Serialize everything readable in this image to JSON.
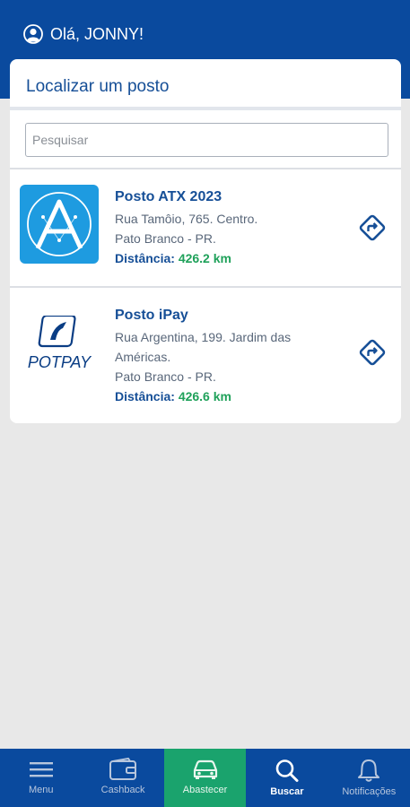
{
  "header": {
    "greeting": "Olá, JONNY!",
    "icon": "user-circle-icon"
  },
  "card": {
    "title": "Localizar um posto",
    "search_placeholder": "Pesquisar"
  },
  "stations": [
    {
      "name": "Posto ATX 2023",
      "address": "Rua Tamôio, 765. Centro.",
      "city": "Pato Branco - PR.",
      "distance_label": "Distância:",
      "distance_value": "426.2 km",
      "logo": "atx-logo"
    },
    {
      "name": "Posto iPay",
      "address": "Rua Argentina, 199. Jardim das Américas.",
      "city": "Pato Branco - PR.",
      "distance_label": "Distância:",
      "distance_value": "426.6 km",
      "logo": "potpay-logo",
      "logo_text": "POTPAY"
    }
  ],
  "nav": [
    {
      "label": "Menu",
      "icon": "hamburger-icon"
    },
    {
      "label": "Cashback",
      "icon": "wallet-icon"
    },
    {
      "label": "Abastecer",
      "icon": "car-icon",
      "state": "highlighted"
    },
    {
      "label": "Buscar",
      "icon": "search-icon",
      "state": "selected"
    },
    {
      "label": "Notificações",
      "icon": "bell-icon"
    }
  ],
  "colors": {
    "primary": "#0a4a9e",
    "title_blue": "#164f97",
    "distance_green": "#1fa15a",
    "nav_highlight": "#1aa36d",
    "atx_logo_bg": "#1e9be0",
    "background": "#e8e8e8"
  }
}
